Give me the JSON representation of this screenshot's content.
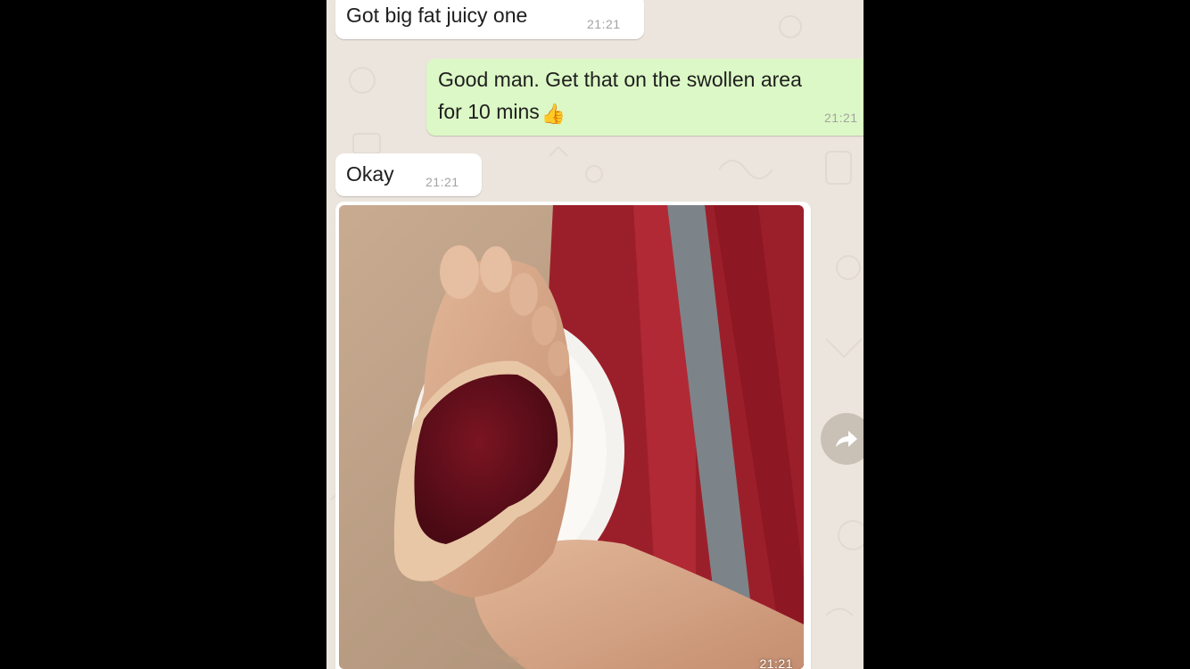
{
  "messages": [
    {
      "direction": "incoming",
      "text": "Got big fat juicy one",
      "time": "21:21"
    },
    {
      "direction": "outgoing",
      "text_line1": "Good man. Get that on the swollen area",
      "text_line2": "for 10 mins",
      "emoji": "👍",
      "time": "21:21"
    },
    {
      "direction": "incoming",
      "text": "Okay",
      "time": "21:21"
    },
    {
      "direction": "incoming",
      "type": "photo",
      "time": "21:21",
      "description_icon": "photo-of-foot-with-steak"
    }
  ],
  "forward_button": {
    "icon": "forward-arrow-icon"
  },
  "colors": {
    "chat_background": "#ece5dd",
    "incoming_bubble": "#ffffff",
    "outgoing_bubble": "#dcf8c6",
    "timestamp": "#a3a3a3",
    "forward_button": "#c9c1b6"
  }
}
